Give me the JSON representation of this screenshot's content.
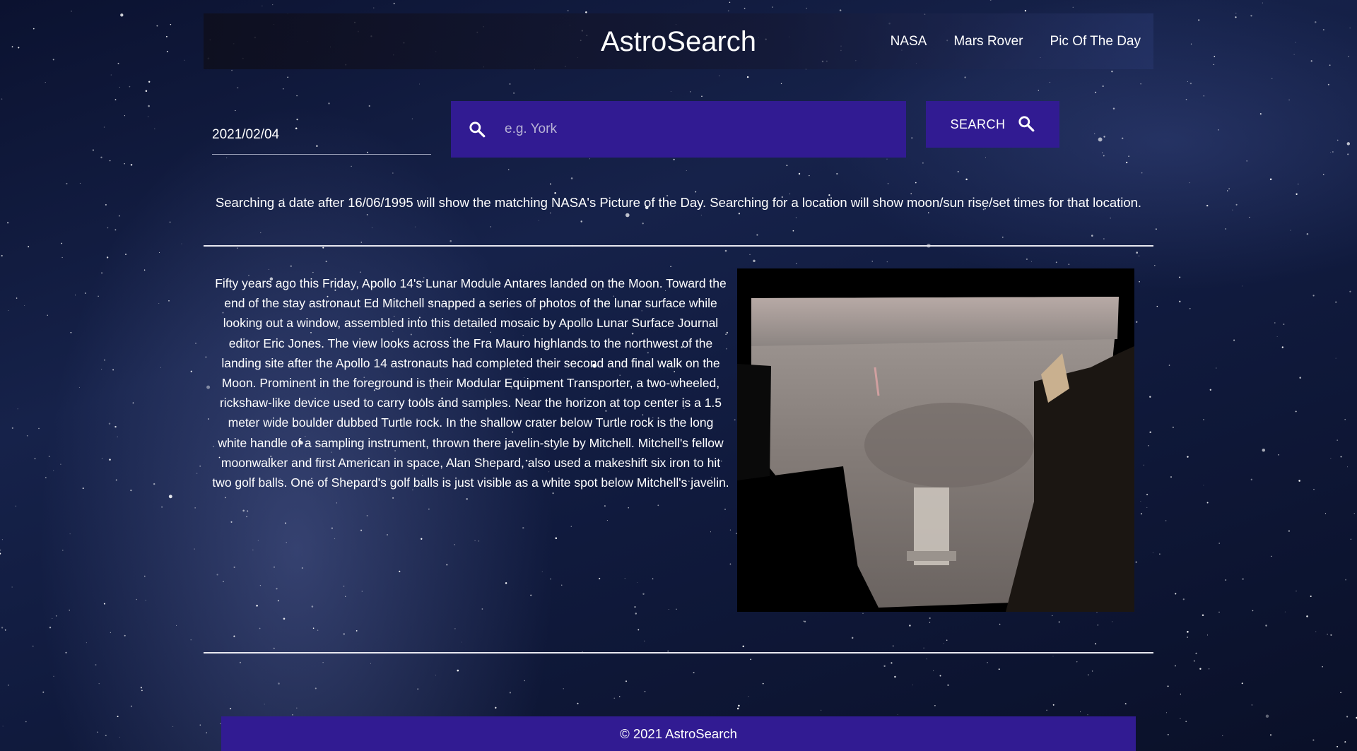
{
  "app": {
    "brand": "AstroSearch"
  },
  "nav": {
    "links": [
      "NASA",
      "Mars Rover",
      "Pic Of The Day"
    ]
  },
  "search": {
    "date_value": "2021/02/04",
    "location_placeholder": "e.g. York",
    "button_label": "SEARCH",
    "hint": "Searching a date after 16/06/1995 will show the matching NASA's Picture of the Day. Searching for a location will show moon/sun rise/set times for that location."
  },
  "apod": {
    "explanation": "Fifty years ago this Friday, Apollo 14's Lunar Module Antares landed on the Moon. Toward the end of the stay astronaut Ed Mitchell snapped a series of photos of the lunar surface while looking out a window, assembled into this detailed mosaic by Apollo Lunar Surface Journal editor Eric Jones. The view looks across the Fra Mauro highlands to the northwest of the landing site after the Apollo 14 astronauts had completed their second and final walk on the Moon. Prominent in the foreground is their Modular Equipment Transporter, a two-wheeled, rickshaw-like device used to carry tools and samples. Near the horizon at top center is a 1.5 meter wide boulder dubbed Turtle rock. In the shallow crater below Turtle rock is the long white handle of a sampling instrument, thrown there javelin-style by Mitchell. Mitchell's fellow moonwalker and first American in space, Alan Shepard, also used a makeshift six iron to hit two golf balls. One of Shepard's golf balls is just visible as a white spot below Mitchell's javelin."
  },
  "footer": {
    "text": "© 2021 AstroSearch"
  },
  "colors": {
    "accent": "#311b92",
    "text": "#ffffff",
    "background": "#101a3d"
  },
  "icons": {
    "search_field": "search-icon",
    "search_button": "search-icon"
  }
}
